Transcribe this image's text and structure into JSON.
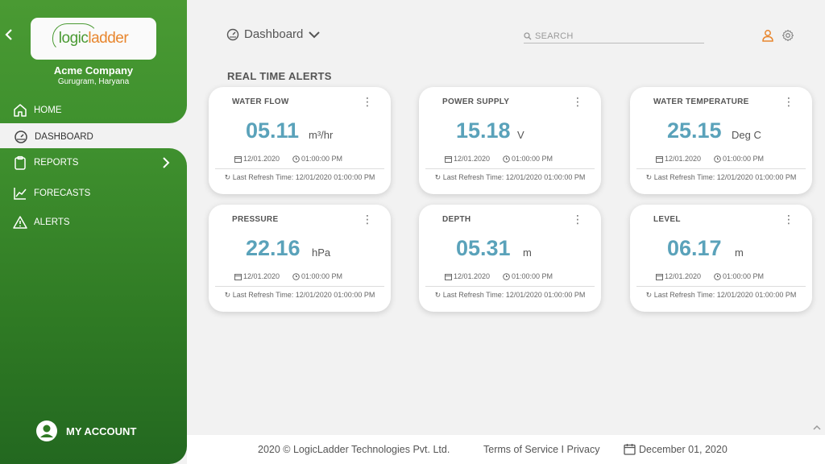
{
  "sidebar": {
    "logo": {
      "part1": "logic",
      "part2": "ladder"
    },
    "company_name": "Acme Company",
    "company_location": "Gurugram, Haryana",
    "items": [
      {
        "label": "HOME",
        "icon": "home-icon"
      },
      {
        "label": "DASHBOARD",
        "icon": "gauge-icon",
        "active": true
      },
      {
        "label": "REPORTS",
        "icon": "clipboard-icon"
      },
      {
        "label": "FORECASTS",
        "icon": "chart-line-icon"
      },
      {
        "label": "ALERTS",
        "icon": "warning-icon"
      }
    ],
    "account_label": "MY ACCOUNT"
  },
  "header": {
    "title": "Dashboard",
    "search_placeholder": "SEARCH"
  },
  "section_title": "REAL TIME ALERTS",
  "cards": [
    {
      "title": "WATER FLOW",
      "value": "05.11",
      "unit": "m³/hr",
      "date": "12/01.2020",
      "time": "01:00:00 PM",
      "refresh": "Last Refresh Time: 12/01/2020 01:00:00 PM"
    },
    {
      "title": "POWER SUPPLY",
      "value": "15.18",
      "unit": "V",
      "date": "12/01.2020",
      "time": "01:00:00 PM",
      "refresh": "Last Refresh Time: 12/01/2020 01:00:00 PM"
    },
    {
      "title": "WATER TEMPERATURE",
      "value": "25.15",
      "unit": "Deg C",
      "date": "12/01.2020",
      "time": "01:00:00 PM",
      "refresh": "Last Refresh Time: 12/01/2020 01:00:00 PM"
    },
    {
      "title": "PRESSURE",
      "value": "22.16",
      "unit": "hPa",
      "date": "12/01.2020",
      "time": "01:00:00 PM",
      "refresh": "Last Refresh Time: 12/01/2020 01:00:00 PM"
    },
    {
      "title": "DEPTH",
      "value": "05.31",
      "unit": "m",
      "date": "12/01.2020",
      "time": "01:00:00 PM",
      "refresh": "Last Refresh Time: 12/01/2020 01:00:00 PM"
    },
    {
      "title": "LEVEL",
      "value": "06.17",
      "unit": "m",
      "date": "12/01.2020",
      "time": "01:00:00 PM",
      "refresh": "Last Refresh Time: 12/01/2020 01:00:00 PM"
    }
  ],
  "footer": {
    "copyright": "2020 © LogicLadder Technologies Pvt. Ltd.",
    "terms": "Terms of Service I Privacy",
    "date": "December 01, 2020"
  },
  "colors": {
    "sidebar_green": "#3f912e",
    "value_blue": "#5aa2ba",
    "accent_orange": "#e8862e"
  }
}
